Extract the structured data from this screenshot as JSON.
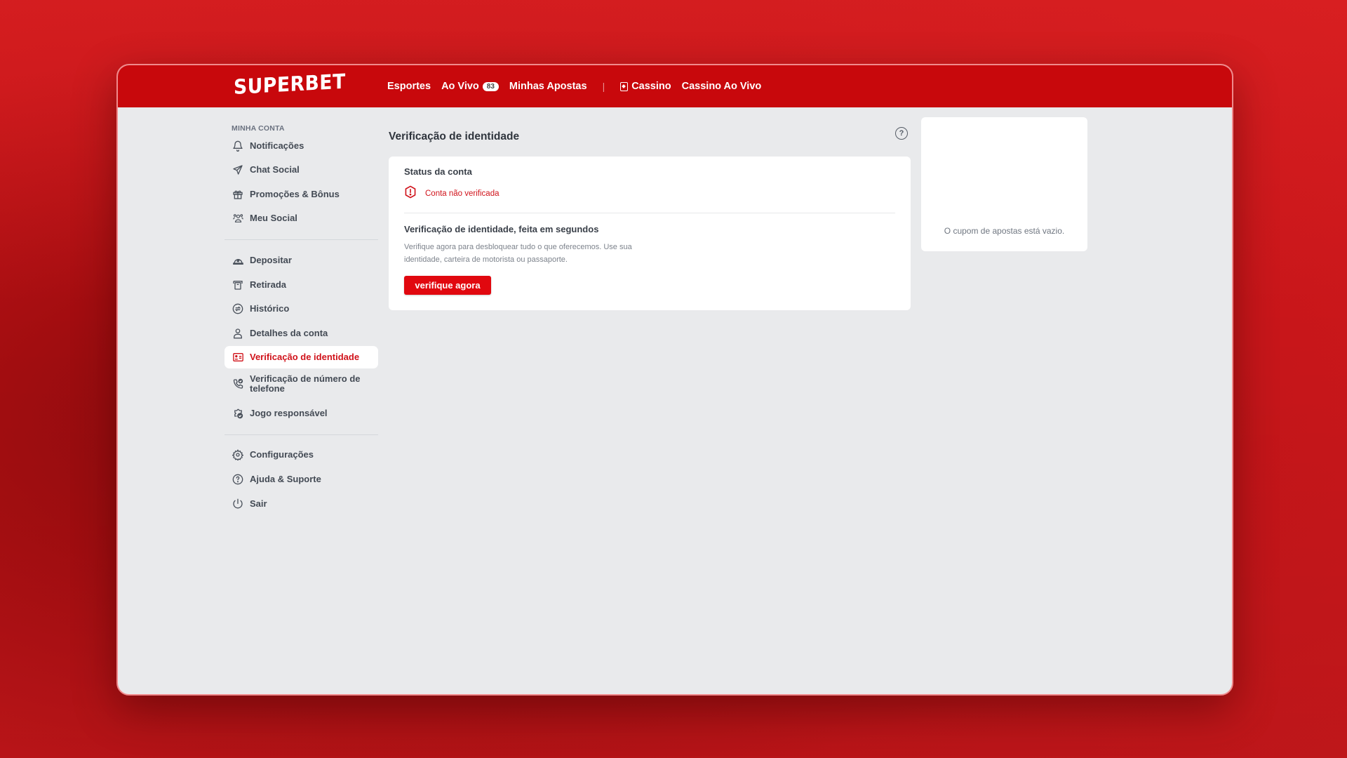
{
  "header": {
    "logo": "SUPERBET",
    "nav": [
      {
        "label": "Esportes"
      },
      {
        "label": "Ao Vivo",
        "badge": "83"
      },
      {
        "label": "Minhas Apostas"
      },
      {
        "label": "Cassino",
        "icon": "cards-icon"
      },
      {
        "label": "Cassino Ao Vivo"
      }
    ],
    "separator": "|"
  },
  "sidebar": {
    "section_title": "MINHA CONTA",
    "groups": [
      [
        {
          "label": "Notificações",
          "icon": "bell-icon"
        },
        {
          "label": "Chat Social",
          "icon": "send-icon"
        },
        {
          "label": "Promoções & Bônus",
          "icon": "gift-icon"
        },
        {
          "label": "Meu Social",
          "icon": "users-icon"
        }
      ],
      [
        {
          "label": "Depositar",
          "icon": "deposit-icon"
        },
        {
          "label": "Retirada",
          "icon": "withdraw-icon"
        },
        {
          "label": "Histórico",
          "icon": "history-icon"
        },
        {
          "label": "Detalhes da conta",
          "icon": "user-icon"
        },
        {
          "label": "Verificação de identidade",
          "icon": "id-card-icon",
          "active": true
        },
        {
          "label": "Verificação de número de telefone",
          "icon": "phone-check-icon"
        },
        {
          "label": "Jogo responsável",
          "icon": "responsible-gaming-icon"
        }
      ],
      [
        {
          "label": "Configurações",
          "icon": "gear-icon"
        },
        {
          "label": "Ajuda & Suporte",
          "icon": "help-icon"
        },
        {
          "label": "Sair",
          "icon": "power-icon"
        }
      ]
    ]
  },
  "main": {
    "title": "Verificação de identidade",
    "help_icon": "?",
    "status_title": "Status da conta",
    "status_text": "Conta não verificada",
    "verification_title": "Verificação de identidade, feita em segundos",
    "verification_desc": "Verifique agora para desbloquear tudo o que oferecemos. Use sua identidade, carteira de motorista ou passaporte.",
    "verify_button": "verifique agora"
  },
  "coupon": {
    "empty_text": "O cupom de apostas está vazio."
  },
  "colors": {
    "brand_red": "#c8080c",
    "button_red": "#e1080f",
    "active_text": "#d0121a"
  }
}
